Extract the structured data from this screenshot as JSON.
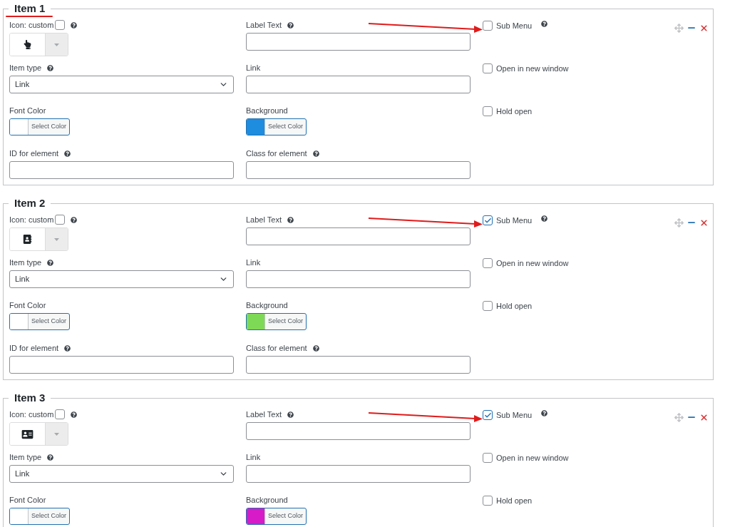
{
  "items": [
    {
      "title": "Item 1",
      "underlined": true,
      "arrow": true,
      "icon_label": "Icon: custom",
      "icon_custom": false,
      "label_text": "Label Text",
      "item_type_label": "Item type",
      "item_type": "Link",
      "link_label": "Link",
      "font_color_label": "Font Color",
      "font_swatch": {
        "color": "#ffffff"
      },
      "font_color_button": "Select Color",
      "background_label": "Background",
      "background_swatch": {
        "color": "#1e8cdf"
      },
      "background_button": "Select Color",
      "id_label": "ID for element",
      "class_label": "Class for element",
      "sub_menu": {
        "label": "Sub Menu",
        "checked": false
      },
      "new_window": {
        "label": "Open in new window",
        "checked": false
      },
      "hold_open": {
        "label": "Hold open",
        "checked": false
      }
    },
    {
      "title": "Item 2",
      "underlined": false,
      "arrow": true,
      "icon_label": "Icon: custom",
      "icon_custom": false,
      "label_text": "Label Text",
      "item_type_label": "Item type",
      "item_type": "Link",
      "link_label": "Link",
      "font_color_label": "Font Color",
      "font_swatch": {
        "color": "#ffffff"
      },
      "font_color_button": "Select Color",
      "background_label": "Background",
      "background_swatch": {
        "color": "#7ed957"
      },
      "background_button": "Select Color",
      "id_label": "ID for element",
      "class_label": "Class for element",
      "sub_menu": {
        "label": "Sub Menu",
        "checked": true
      },
      "new_window": {
        "label": "Open in new window",
        "checked": false
      },
      "hold_open": {
        "label": "Hold open",
        "checked": false
      }
    },
    {
      "title": "Item 3",
      "underlined": false,
      "arrow": true,
      "icon_label": "Icon: custom",
      "icon_custom": false,
      "label_text": "Label Text",
      "item_type_label": "Item type",
      "item_type": "Link",
      "link_label": "Link",
      "font_color_label": "Font Color",
      "font_swatch": {
        "color": "#ffffff"
      },
      "font_color_button": "Select Color",
      "background_label": "Background",
      "background_swatch": {
        "color": "#d81bc9"
      },
      "background_button": "Select Color",
      "sub_menu": {
        "label": "Sub Menu",
        "checked": true
      },
      "new_window": {
        "label": "Open in new window",
        "checked": false
      },
      "hold_open": {
        "label": "Hold open",
        "checked": false
      }
    }
  ]
}
